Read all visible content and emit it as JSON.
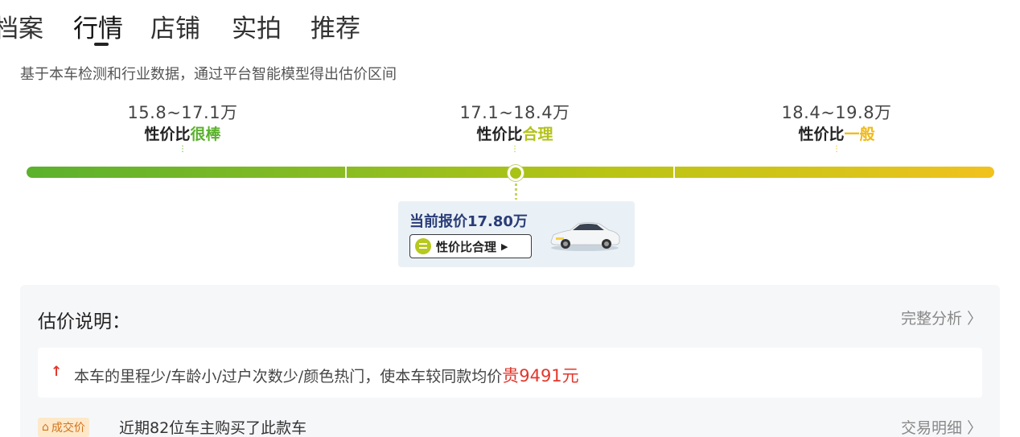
{
  "tabs": [
    {
      "label": "档案"
    },
    {
      "label": "行情"
    },
    {
      "label": "店铺"
    },
    {
      "label": "实拍"
    },
    {
      "label": "推荐"
    }
  ],
  "subtitle": "基于本车检测和行业数据，通过平台智能模型得出估价区间",
  "ranges": [
    {
      "price": "15.8~17.1万",
      "prefix": "性价比",
      "rating": "很棒",
      "color": "#5bb12d"
    },
    {
      "price": "17.1~18.4万",
      "prefix": "性价比",
      "rating": "合理",
      "color": "#b3c21a"
    },
    {
      "price": "18.4~19.8万",
      "prefix": "性价比",
      "rating": "一般",
      "color": "#f0b916"
    }
  ],
  "current": {
    "label": "当前报价17.80万",
    "badge": "性价比合理",
    "arrow": "▶",
    "position_fraction": 0.505
  },
  "panel": {
    "title": "估价说明：",
    "link": "完整分析 〉",
    "reason_icon": "arrow-up-icon",
    "reason_text": "本车的里程少/车龄小/过户次数少/颜色热门，使本车较同款均价",
    "reason_highlight": "贵9491元",
    "deal_badge": "成交价",
    "deal_text": "近期82位车主购买了此款车",
    "deal_link": "交易明细 〉"
  },
  "colors": {
    "accent_red": "#e2372c",
    "good_green": "#5bb12d",
    "ok_yellowgreen": "#b3c21a",
    "fair_yellow": "#f0b916"
  }
}
